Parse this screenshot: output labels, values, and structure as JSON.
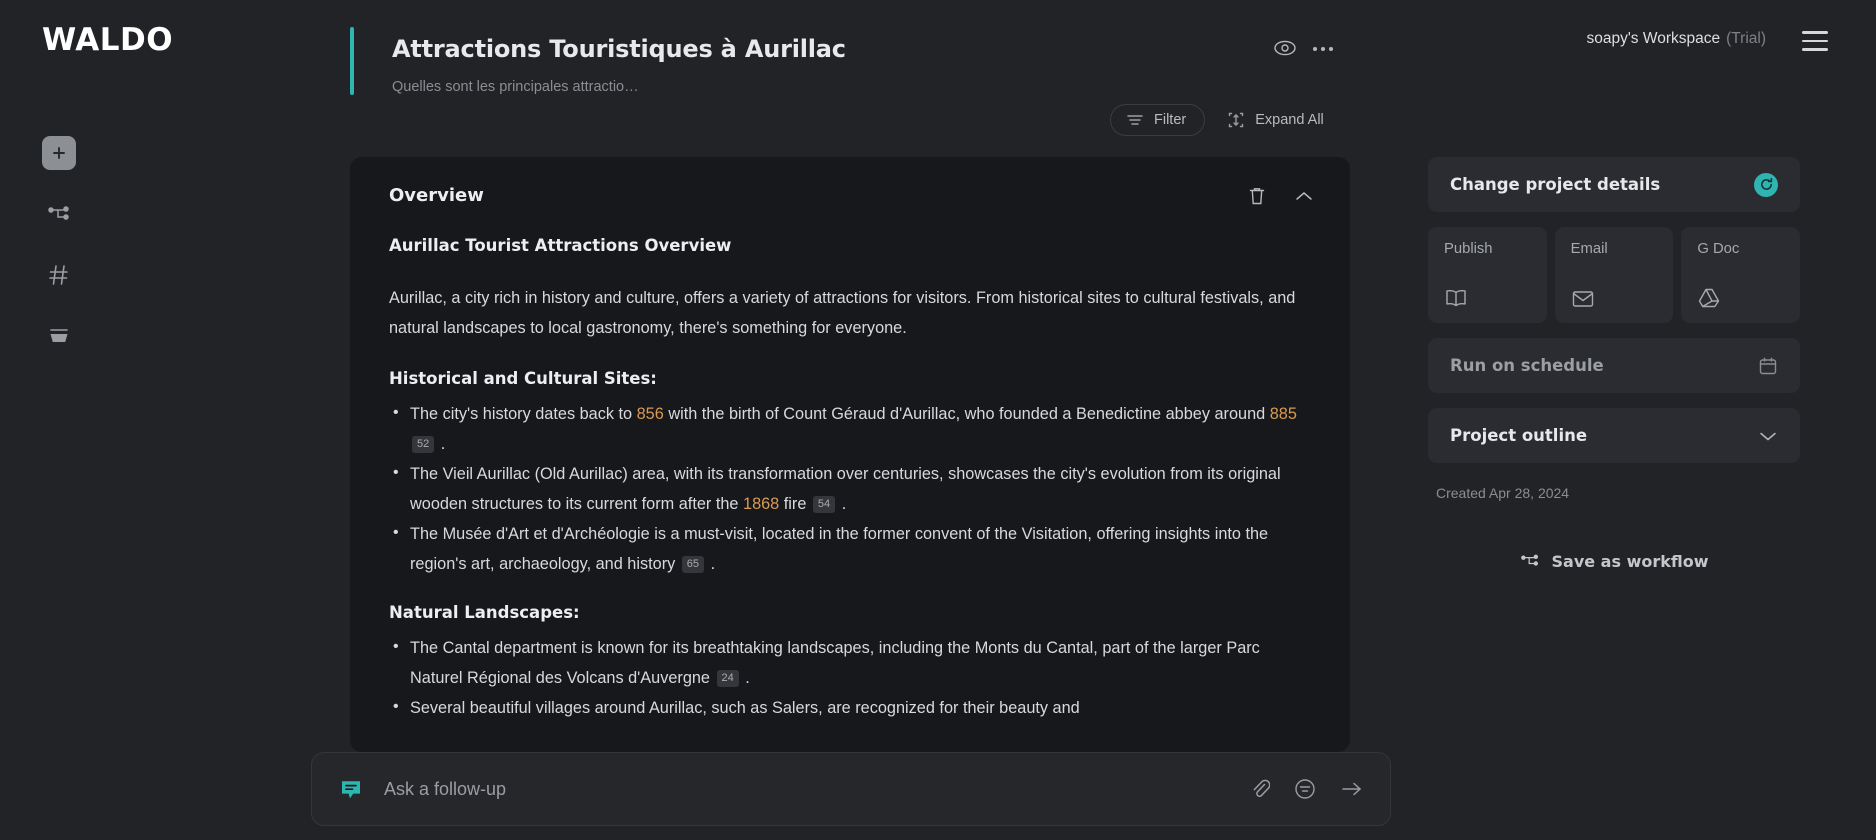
{
  "brand": {
    "logo": "WALDO"
  },
  "sidebar": {
    "items": [
      {
        "name": "new-project",
        "icon": "plus-icon"
      },
      {
        "name": "workflows",
        "icon": "workflow-icon"
      },
      {
        "name": "channels",
        "icon": "hash-icon"
      },
      {
        "name": "library",
        "icon": "stack-icon"
      }
    ]
  },
  "header": {
    "title": "Attractions Touristiques à Aurillac",
    "subtitle": "Quelles sont les principales attractio…",
    "workspace": "soapy's Workspace",
    "plan": "(Trial)",
    "accent_color": "#2eb5b2"
  },
  "toolbar": {
    "filter_label": "Filter",
    "expand_label": "Expand All"
  },
  "card": {
    "heading": "Overview",
    "body_title": "Aurillac Tourist Attractions Overview",
    "intro": "Aurillac, a city rich in history and culture, offers a variety of attractions for visitors. From historical sites to cultural festivals, and natural landscapes to local gastronomy, there's something for everyone.",
    "sections": [
      {
        "title": "Historical and Cultural Sites:",
        "bullets": [
          {
            "parts": [
              {
                "t": "The city's history dates back to "
              },
              {
                "t": "856",
                "k": "year"
              },
              {
                "t": " with the birth of Count Géraud d'Aurillac, who founded a Benedictine abbey around "
              },
              {
                "t": "885",
                "k": "year"
              },
              {
                "t": " "
              },
              {
                "t": "52",
                "k": "cite"
              },
              {
                "t": " ."
              }
            ]
          },
          {
            "parts": [
              {
                "t": "The Vieil Aurillac (Old Aurillac) area, with its transformation over centuries, showcases the city's evolution from its original wooden structures to its current form after the "
              },
              {
                "t": "1868",
                "k": "year"
              },
              {
                "t": " fire "
              },
              {
                "t": "54",
                "k": "cite"
              },
              {
                "t": " ."
              }
            ]
          },
          {
            "parts": [
              {
                "t": "The Musée d'Art et d'Archéologie is a must-visit, located in the former convent of the Visitation, offering insights into the region's art, archaeology, and history "
              },
              {
                "t": "65",
                "k": "cite"
              },
              {
                "t": " ."
              }
            ]
          }
        ]
      },
      {
        "title": "Natural Landscapes:",
        "bullets": [
          {
            "parts": [
              {
                "t": "The Cantal department is known for its breathtaking landscapes, including the Monts du Cantal, part of the larger Parc Naturel Régional des Volcans d'Auvergne "
              },
              {
                "t": "24",
                "k": "cite"
              },
              {
                "t": " ."
              }
            ]
          },
          {
            "parts": [
              {
                "t": "Several beautiful villages around Aurillac, such as Salers, are recognized for their beauty and"
              }
            ]
          }
        ]
      }
    ]
  },
  "right_panel": {
    "change_details": "Change project details",
    "tiles": [
      {
        "label": "Publish",
        "icon": "book-icon"
      },
      {
        "label": "Email",
        "icon": "envelope-icon"
      },
      {
        "label": "G Doc",
        "icon": "google-drive-icon"
      }
    ],
    "run_schedule": "Run on schedule",
    "project_outline": "Project outline",
    "created": "Created Apr 28, 2024",
    "save_workflow": "Save as workflow"
  },
  "followup": {
    "placeholder": "Ask a follow-up"
  }
}
